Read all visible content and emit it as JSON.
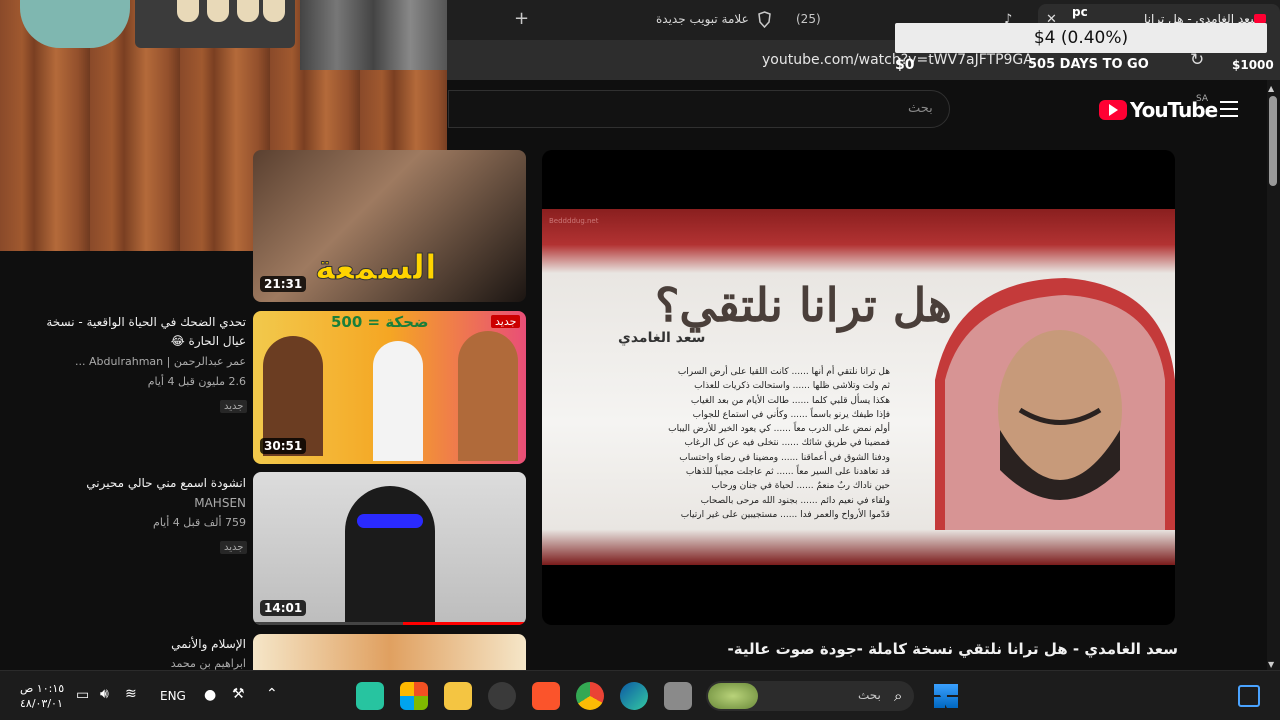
{
  "browser": {
    "active_tab_title": "سعد الغامدي - هل ترانا نلتقي نسخة",
    "tab_count": "(25)",
    "new_tab_label": "علامة تبويب جديدة",
    "url": "youtube.com/watch?v=tWV7aJFTP9GA",
    "pc_label": "pc"
  },
  "overlay": {
    "price": "$4 (0.40%)",
    "days_to_go": "505 DAYS TO GO",
    "left_amount": "$0",
    "right_amount": "$1000"
  },
  "youtube": {
    "logo_text": "YouTube",
    "region": "SA",
    "search_placeholder": "بحث"
  },
  "video": {
    "title": "سعد الغامدي - هل ترانا نلتقي نسخة كاملة -جودة صوت عالية-",
    "frame_title": "هل ترانا نلتقي؟",
    "frame_author": "سعد الغامدي",
    "watermark": "Beddddug.net",
    "poem_lines": [
      "هل ترانا نلتقي أم أنها ...... كانت اللقيا على أرض السراب",
      "ثم ولت وتلاشى ظلها ...... واستحالت ذكريات للعذاب",
      "هكذا يسأل قلبي كلما ...... طالت الأيام من بعد الغياب",
      "فإذا طيفك يرنو باسماً ...... وكأني في استماع للجواب",
      "أولم نمض على الدرب معاً ...... كي يعود الخير للأرض اليباب",
      "فمضينا في طريق شائك ...... نتخلى فيه عن كل الرغاب",
      "ودفنا الشوق في أعماقنا ...... ومضينا في رضاء واحتساب",
      "قد تعاهدنا على السير معاً ...... ثم عاجلت مجيباً للذهاب",
      "حين ناداك ربٌ منعمٌ ...... لحياة في جنان ورحاب",
      "ولقاء في نعيم دائم ...... بجنود الله مرحى بالصحاب",
      "قدّموا الأرواح والعمر فدا ...... مستجيبين على غير ارتياب"
    ]
  },
  "sidebar": {
    "items": [
      {
        "duration": "21:31",
        "thumb_text": "السمعة"
      },
      {
        "title": "تحدي الضحك في الحياة الواقعية - نسخة عيال الحارة 😂",
        "channel": "عمر عبدالرحمن | Abdulrahman ...",
        "views": "2.6 مليون",
        "age": "قبل 4 أيام",
        "new": "جديد",
        "duration": "30:51",
        "badge": "جديد",
        "thumb_text": "ضحكة = 500"
      },
      {
        "title": "انشودة اسمع مني حالي محيرني",
        "channel": "MAHSEN",
        "views": "759 ألف",
        "age": "قبل 4 أيام",
        "new": "جديد",
        "duration": "14:01"
      },
      {
        "title": "الإسلام والأنمي",
        "channel": "ابراهيم بن محمد"
      }
    ]
  },
  "taskbar": {
    "time": "١٠:١٥ ص",
    "date": "٤٨/٠٣/٠١",
    "language": "ENG",
    "search_placeholder": "بحث"
  }
}
